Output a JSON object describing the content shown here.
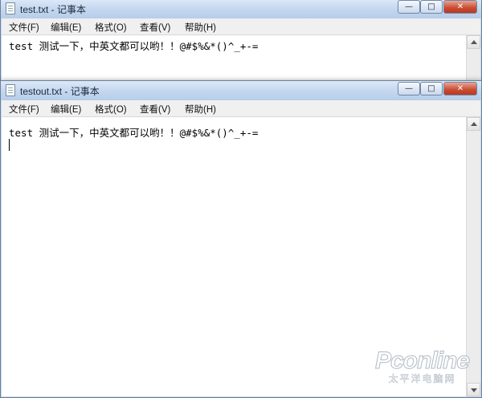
{
  "windows": {
    "back": {
      "title": "test.txt - 记事本",
      "content": "test 测试一下，中英文都可以哟！！@#$%&*()^_+-="
    },
    "front": {
      "title": "testout.txt - 记事本",
      "content": "test 测试一下，中英文都可以哟！！@#$%&*()^_+-="
    }
  },
  "menu": {
    "file": "文件(F)",
    "edit": "编辑(E)",
    "format": "格式(O)",
    "view": "查看(V)",
    "help": "帮助(H)"
  },
  "controls": {
    "minimize": "—",
    "maximize": "□",
    "close": "✕"
  },
  "watermark": {
    "logo": "Pconline",
    "sub": "太平洋电脑网"
  },
  "icons": [
    "notepad-icon",
    "minimize-icon",
    "maximize-icon",
    "close-icon",
    "scroll-up-icon",
    "scroll-down-icon"
  ]
}
